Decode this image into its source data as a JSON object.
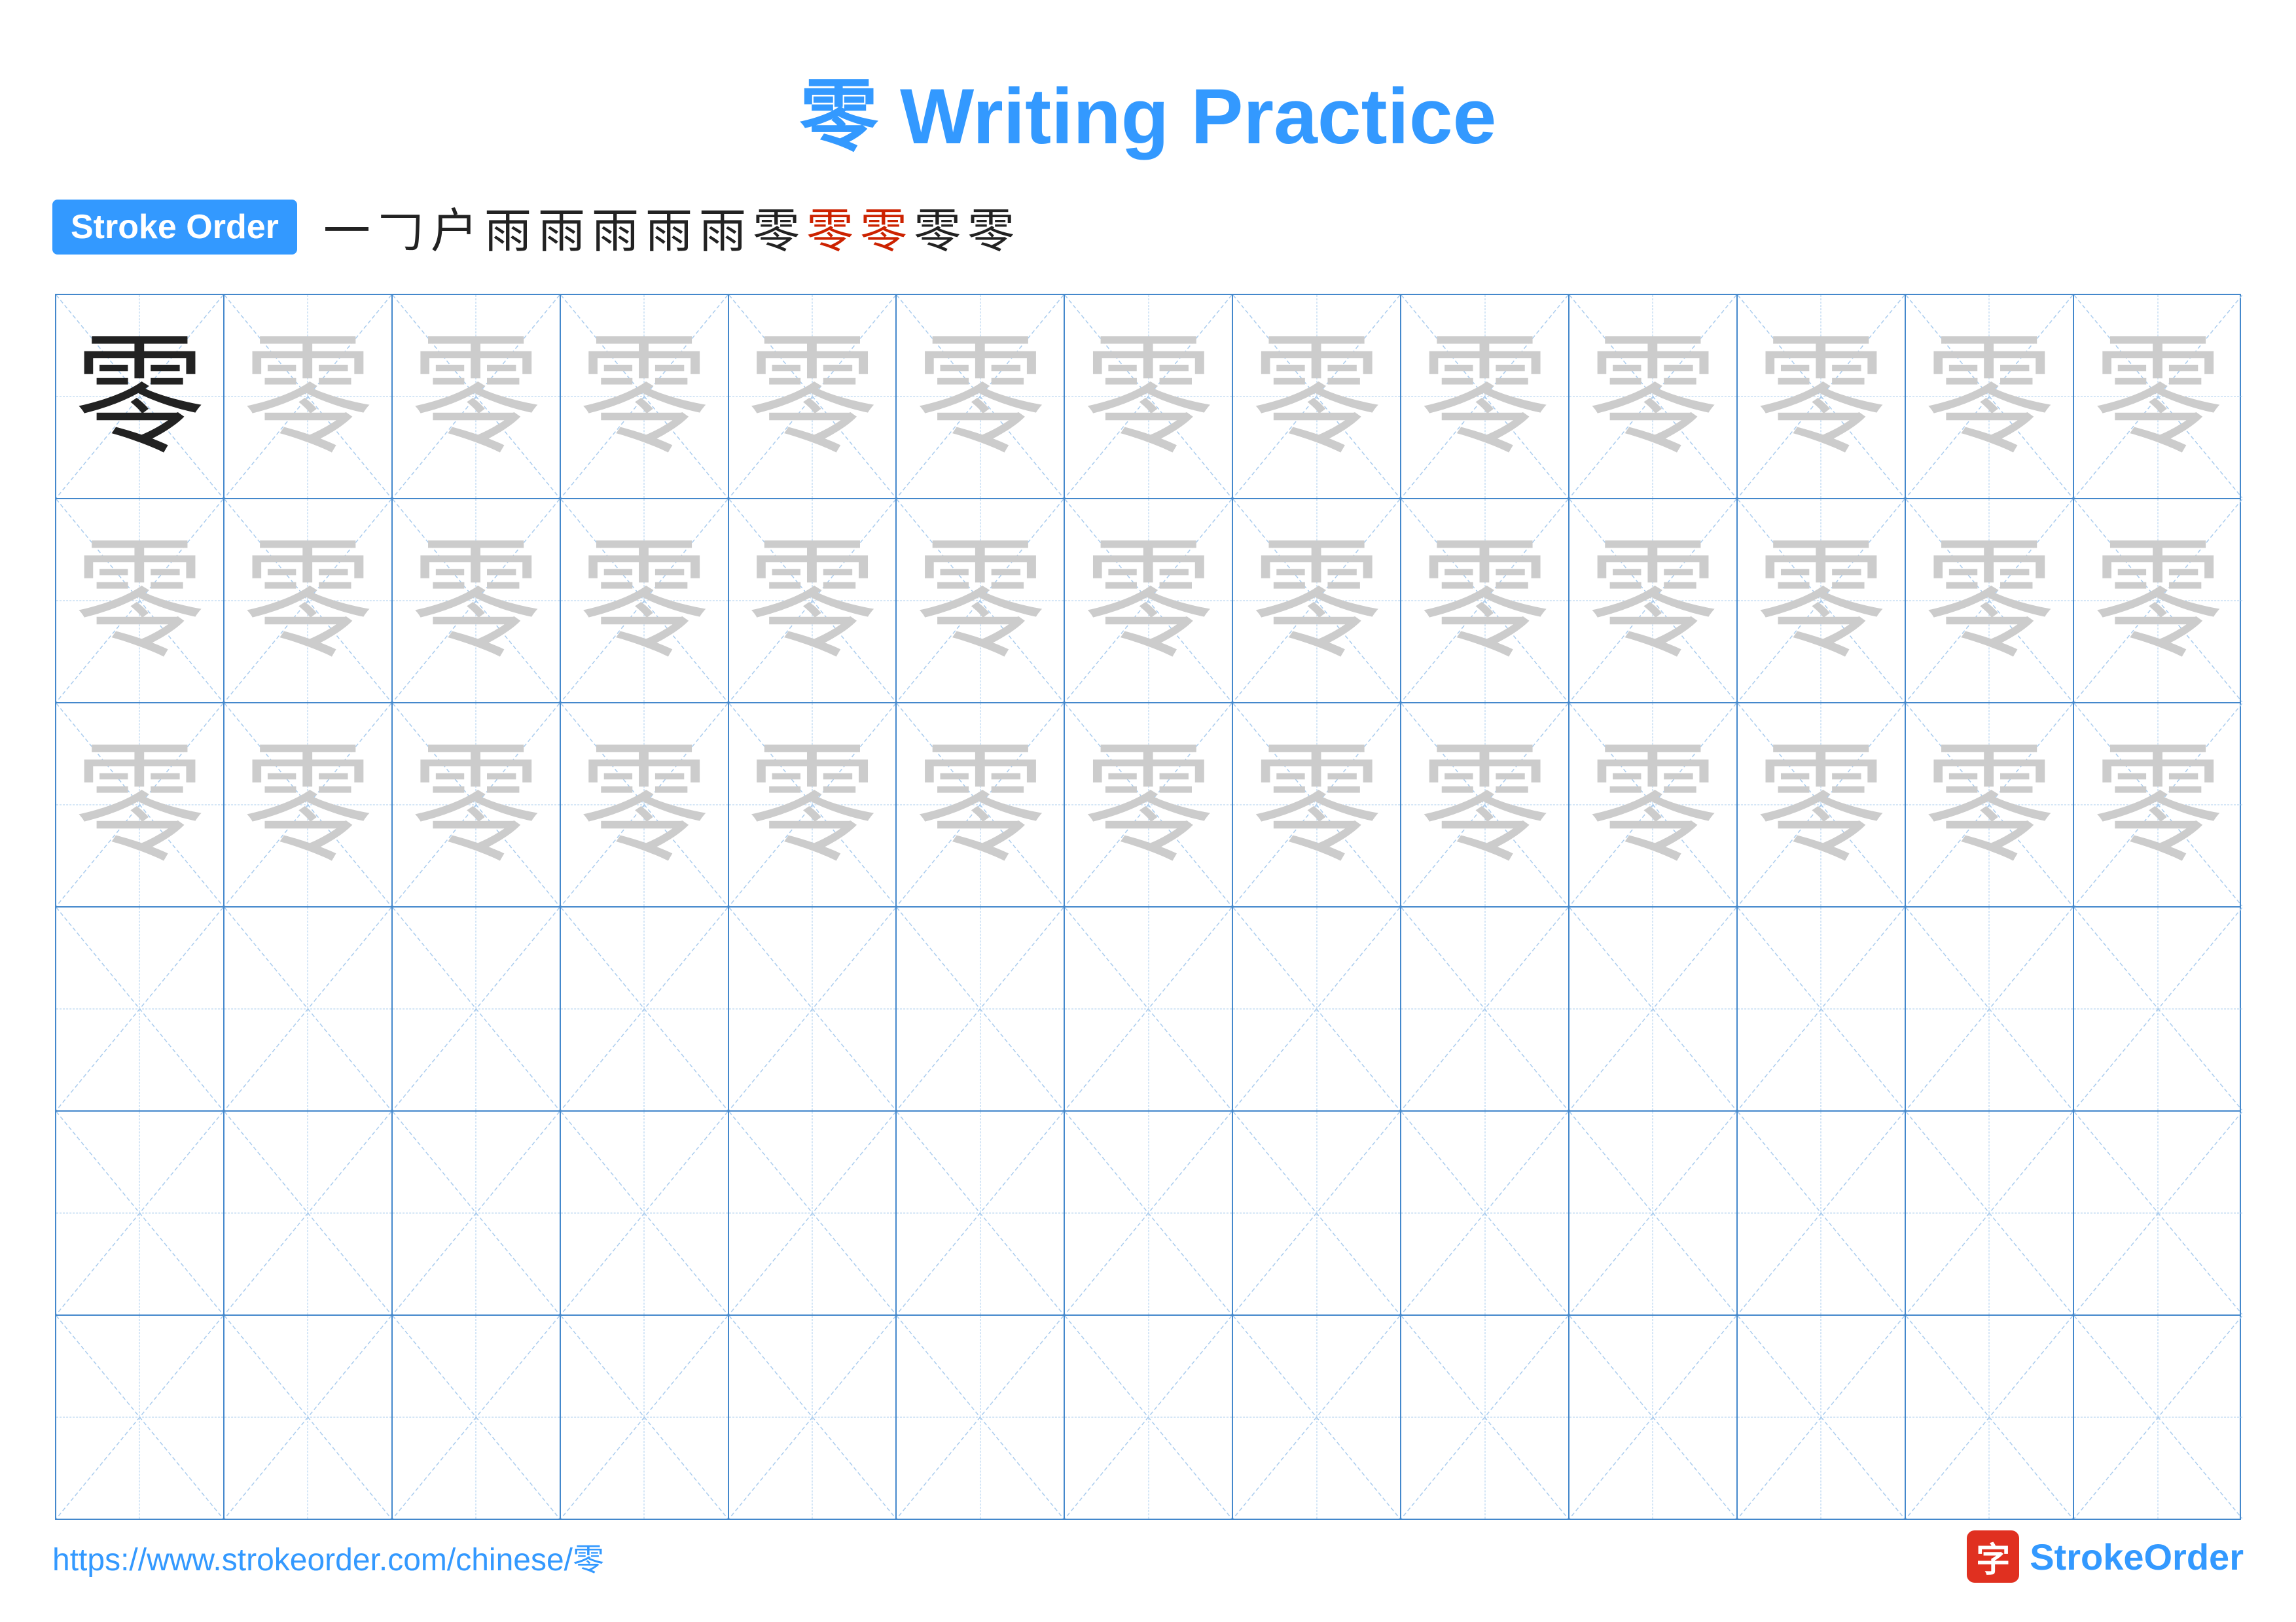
{
  "title": {
    "char": "零",
    "text": " Writing Practice"
  },
  "stroke_order": {
    "badge_label": "Stroke Order",
    "strokes": [
      "一",
      "𠃌",
      "户",
      "雨",
      "雨",
      "雨",
      "雨",
      "雨",
      "零",
      "零",
      "零",
      "零",
      "零"
    ],
    "red_start_index": 8
  },
  "grid": {
    "rows": 6,
    "cols": 13,
    "char": "零"
  },
  "footer": {
    "url": "https://www.strokeorder.com/chinese/零",
    "logo_char": "字",
    "logo_name": "StrokeOrder"
  },
  "colors": {
    "blue": "#3399ff",
    "red": "#cc2200",
    "dark": "#222222",
    "light_char": "#cccccc",
    "medium_char": "#aaaaaa",
    "grid_line": "#4488cc",
    "guide_line": "#aaccee"
  }
}
